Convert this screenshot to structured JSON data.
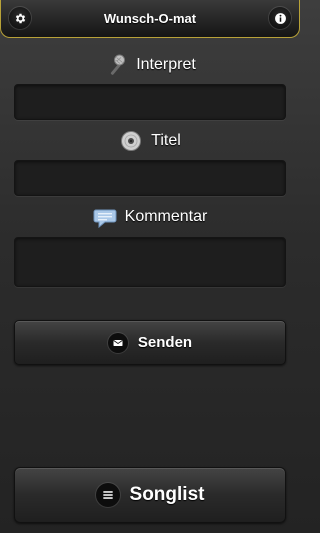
{
  "header": {
    "title": "Wunsch-O-mat",
    "left_icon": "gear-icon",
    "right_icon": "info-icon",
    "border_color": "#b8a238"
  },
  "form": {
    "artist": {
      "label": "Interpret",
      "icon": "microphone-icon",
      "value": ""
    },
    "title": {
      "label": "Titel",
      "icon": "disc-icon",
      "value": ""
    },
    "comment": {
      "label": "Kommentar",
      "icon": "speech-bubble-icon",
      "value": ""
    }
  },
  "actions": {
    "send_label": "Senden",
    "send_icon": "envelope-icon",
    "songlist_label": "Songlist",
    "songlist_icon": "list-icon"
  }
}
